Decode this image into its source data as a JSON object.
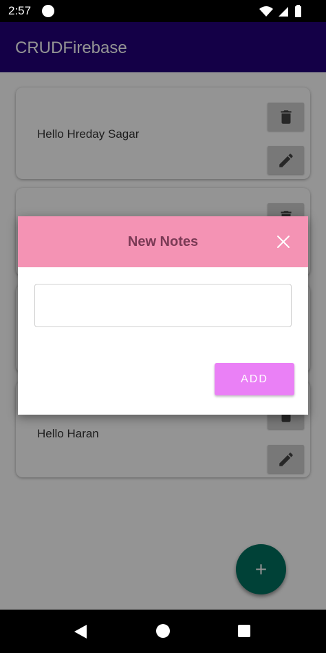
{
  "status_bar": {
    "time": "2:57"
  },
  "app_bar": {
    "title": "CRUDFirebase"
  },
  "notes": [
    {
      "text": "Hello Hreday Sagar"
    },
    {
      "text": ""
    },
    {
      "text": ""
    },
    {
      "text": "Hello Haran"
    }
  ],
  "dialog": {
    "title": "New Notes",
    "input_value": "",
    "add_label": "ADD"
  },
  "colors": {
    "app_bar": "#24007a",
    "dialog_header": "#f493b4",
    "add_button": "#ea80f6",
    "fab": "#007060"
  },
  "icons": [
    "trash-icon",
    "pencil-icon",
    "close-icon",
    "plus-icon",
    "wifi-icon",
    "signal-icon",
    "battery-icon",
    "back-icon",
    "home-icon",
    "recents-icon"
  ]
}
